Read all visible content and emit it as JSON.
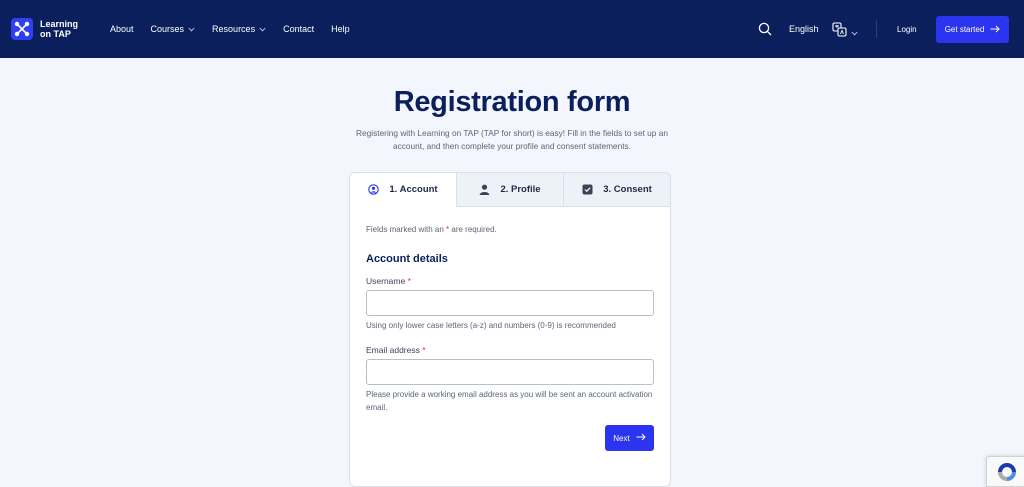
{
  "brand": {
    "name": "Learning on TAP",
    "accent": "#2b35ef",
    "header_bg": "#0b1f5c"
  },
  "nav": {
    "items": [
      {
        "label": "About",
        "has_menu": false
      },
      {
        "label": "Courses",
        "has_menu": true
      },
      {
        "label": "Resources",
        "has_menu": true
      },
      {
        "label": "Contact",
        "has_menu": false
      },
      {
        "label": "Help",
        "has_menu": false
      }
    ],
    "search_icon": "search-icon",
    "language": "English",
    "translate_icon": "translate-icon",
    "login": "Login",
    "cta": "Get started"
  },
  "page": {
    "title": "Registration form",
    "intro": "Registering with Learning on TAP (TAP for short) is easy! Fill in the fields to set up an account, and then complete your profile and consent statements."
  },
  "tabs": [
    {
      "label": "1. Account",
      "icon": "user-circle-icon",
      "active": true
    },
    {
      "label": "2. Profile",
      "icon": "user-icon",
      "active": false
    },
    {
      "label": "3. Consent",
      "icon": "checkbox-icon",
      "active": false
    }
  ],
  "form": {
    "required_note_pre": "Fields marked with an ",
    "required_note_star": "*",
    "required_note_post": " are required.",
    "section_title": "Account details",
    "username": {
      "label": "Username",
      "star": "*",
      "value": "",
      "help": "Using only lower case letters (a-z) and numbers (0-9) is recommended"
    },
    "email": {
      "label": "Email address",
      "star": "*",
      "value": "",
      "help": "Please provide a working email address as you will be sent an account activation email."
    },
    "next": "Next"
  }
}
